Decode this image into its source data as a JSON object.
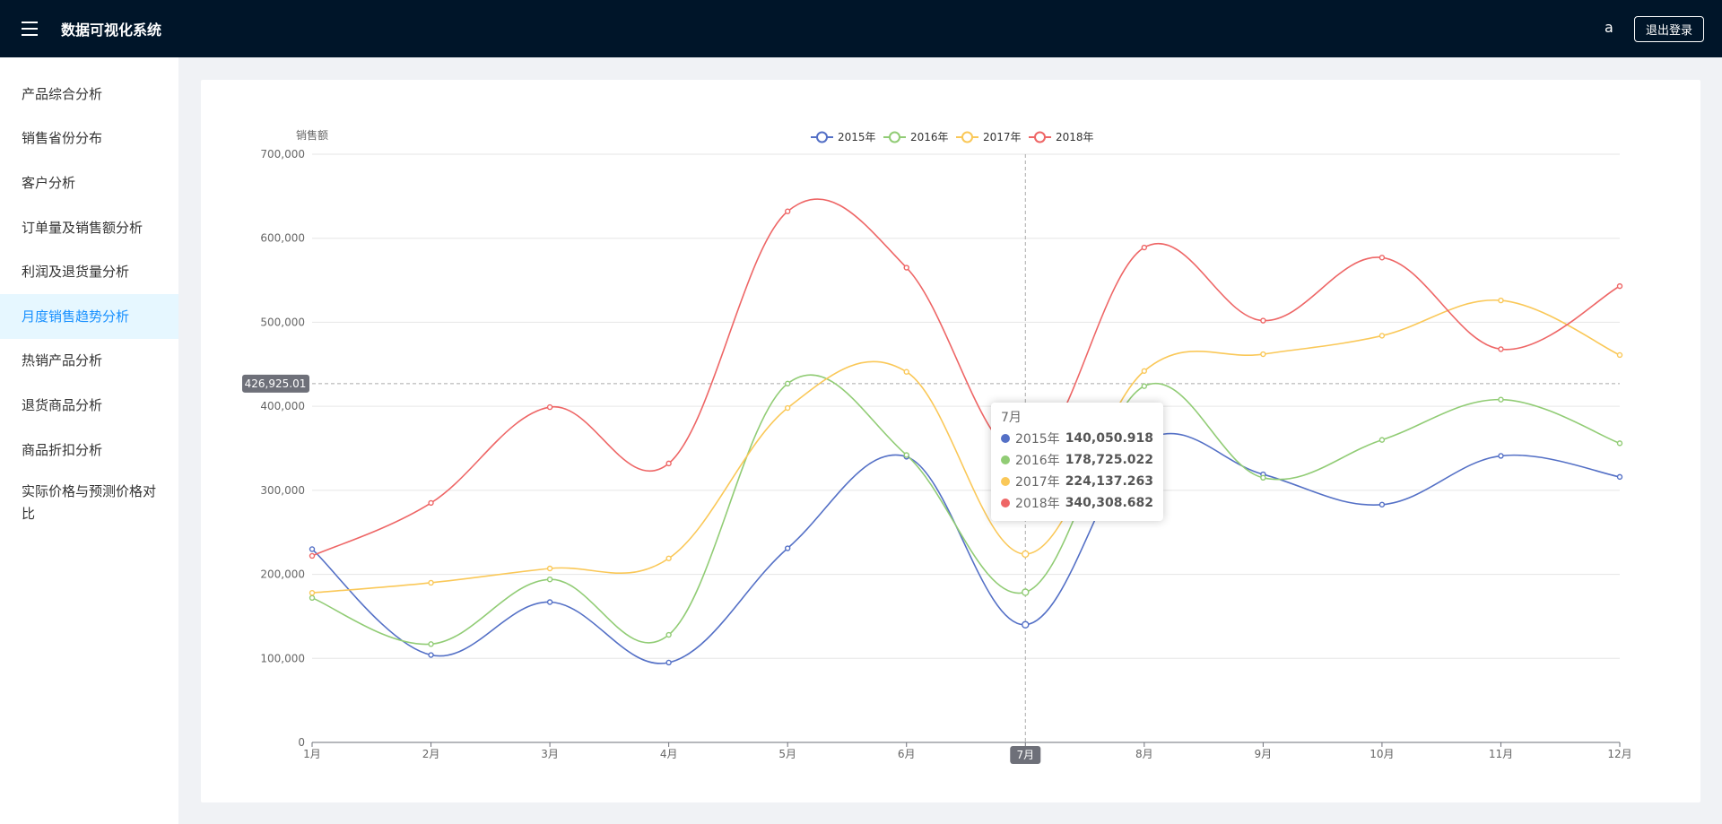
{
  "header": {
    "title": "数据可视化系统",
    "user": "a",
    "logout_label": "退出登录"
  },
  "sidebar": {
    "items": [
      {
        "label": "产品综合分析"
      },
      {
        "label": "销售省份分布"
      },
      {
        "label": "客户分析"
      },
      {
        "label": "订单量及销售额分析"
      },
      {
        "label": "利润及退货量分析"
      },
      {
        "label": "月度销售趋势分析",
        "active": true
      },
      {
        "label": "热销产品分析"
      },
      {
        "label": "退货商品分析"
      },
      {
        "label": "商品折扣分析"
      },
      {
        "label": "实际价格与预测价格对比"
      }
    ]
  },
  "chart_data": {
    "type": "line",
    "smooth": true,
    "title": "",
    "xlabel": "",
    "ylabel": "销售额",
    "categories": [
      "1月",
      "2月",
      "3月",
      "4月",
      "5月",
      "6月",
      "7月",
      "8月",
      "9月",
      "10月",
      "11月",
      "12月"
    ],
    "yticks": [
      "0",
      "100,000",
      "200,000",
      "300,000",
      "400,000",
      "500,000",
      "600,000",
      "700,000"
    ],
    "ylim": [
      0,
      700000
    ],
    "grid": true,
    "legend_position": "top-center",
    "series": [
      {
        "name": "2015年",
        "color": "#5470c6",
        "values": [
          230000,
          104000,
          167000,
          95000,
          231000,
          340000,
          140050.918,
          358000,
          319000,
          283000,
          341000,
          316000
        ]
      },
      {
        "name": "2016年",
        "color": "#91cc75",
        "values": [
          172000,
          117000,
          194000,
          128000,
          427000,
          342000,
          178725.022,
          424000,
          315000,
          360000,
          408000,
          356000
        ]
      },
      {
        "name": "2017年",
        "color": "#fac858",
        "values": [
          178000,
          190000,
          207000,
          219000,
          398000,
          441000,
          224137.263,
          442000,
          462000,
          484000,
          526000,
          461000
        ]
      },
      {
        "name": "2018年",
        "color": "#ee6666",
        "values": [
          222000,
          285000,
          399000,
          332000,
          632000,
          565000,
          340308.682,
          589000,
          502000,
          577000,
          468000,
          543000
        ]
      }
    ],
    "axis_pointer": {
      "category": "7月",
      "y_value_label": "426,925.01"
    },
    "tooltip": {
      "title": "7月",
      "rows": [
        {
          "name": "2015年",
          "value": "140,050.918",
          "color": "#5470c6"
        },
        {
          "name": "2016年",
          "value": "178,725.022",
          "color": "#91cc75"
        },
        {
          "name": "2017年",
          "value": "224,137.263",
          "color": "#fac858"
        },
        {
          "name": "2018年",
          "value": "340,308.682",
          "color": "#ee6666"
        }
      ]
    }
  }
}
